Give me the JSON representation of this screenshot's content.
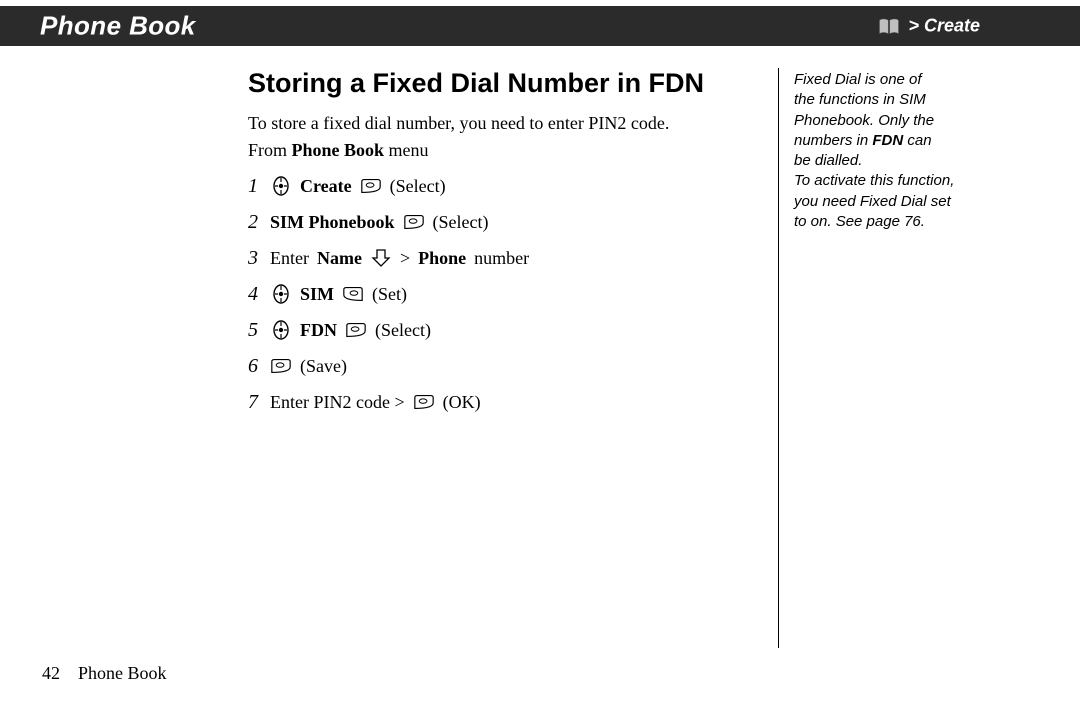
{
  "header": {
    "title": "Phone Book",
    "breadcrumb": "> Create"
  },
  "main": {
    "heading": "Storing a Fixed Dial Number in FDN",
    "intro": "To store a fixed dial number, you need to enter PIN2 code.",
    "from_pre": "From ",
    "from_bold": "Phone Book",
    "from_post": " menu"
  },
  "steps": [
    {
      "num": "1",
      "parts": [
        {
          "icon": "nav"
        },
        {
          "bold": "Create"
        },
        {
          "icon": "soft-left"
        },
        {
          "text": "(Select)"
        }
      ]
    },
    {
      "num": "2",
      "parts": [
        {
          "bold": "SIM Phonebook"
        },
        {
          "icon": "soft-left"
        },
        {
          "text": "(Select)"
        }
      ]
    },
    {
      "num": "3",
      "parts": [
        {
          "text": "Enter "
        },
        {
          "bold": "Name"
        },
        {
          "icon": "down"
        },
        {
          "text": " > "
        },
        {
          "bold": "Phone"
        },
        {
          "text": " number"
        }
      ]
    },
    {
      "num": "4",
      "parts": [
        {
          "icon": "nav"
        },
        {
          "bold": "SIM"
        },
        {
          "icon": "soft-right"
        },
        {
          "text": "(Set)"
        }
      ]
    },
    {
      "num": "5",
      "parts": [
        {
          "icon": "nav"
        },
        {
          "bold": "FDN"
        },
        {
          "icon": "soft-left"
        },
        {
          "text": "(Select)"
        }
      ]
    },
    {
      "num": "6",
      "parts": [
        {
          "icon": "soft-left"
        },
        {
          "text": "(Save)"
        }
      ]
    },
    {
      "num": "7",
      "parts": [
        {
          "text": "Enter PIN2 code > "
        },
        {
          "icon": "soft-left"
        },
        {
          "text": "(OK)"
        }
      ]
    }
  ],
  "sidenote": {
    "l1a": "Fixed Dial is one of",
    "l1b": "the functions in SIM",
    "l1c": "Phonebook. Only the",
    "l2a": "numbers in ",
    "l2bold": "FDN",
    "l2b": " can",
    "l3": "be dialled.",
    "l4": "To activate this function,",
    "l5": "you need Fixed Dial set",
    "l6": "to on. See page 76."
  },
  "footer": {
    "page": "42",
    "section": "Phone Book"
  },
  "icons": {
    "nav": "nav-icon",
    "soft_left": "soft-left-icon",
    "soft_right": "soft-right-icon",
    "down": "down-icon",
    "books": "books-icon"
  }
}
